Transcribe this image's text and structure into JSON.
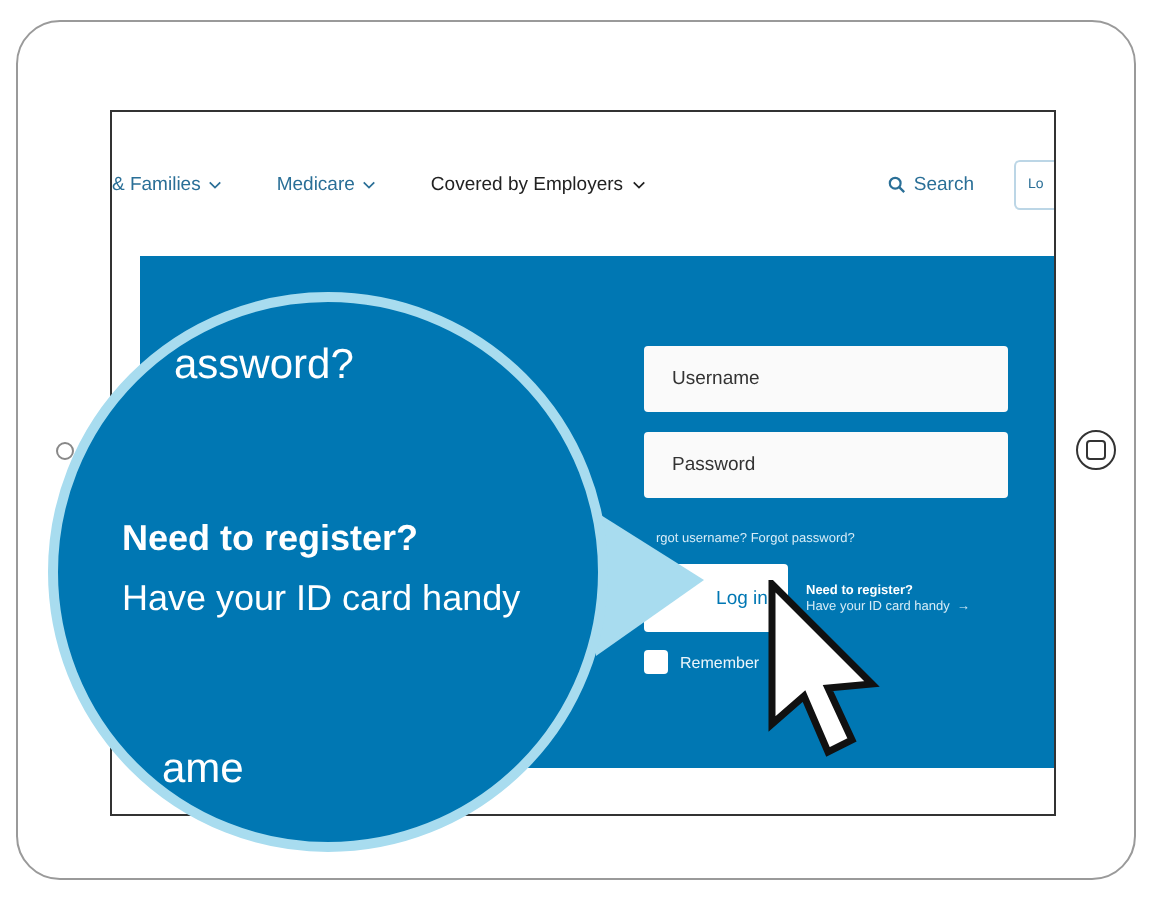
{
  "nav": {
    "items": [
      {
        "label": "& Families",
        "selected": false
      },
      {
        "label": "Medicare",
        "selected": false
      },
      {
        "label": "Covered by Employers",
        "selected": true
      }
    ],
    "search": "Search",
    "login_button": "Lo"
  },
  "login": {
    "username_placeholder": "Username",
    "password_placeholder": "Password",
    "forgot": "rgot username? Forgot password?",
    "login_button": "Log in",
    "register_title": "Need to register?",
    "register_link": "Have your ID card handy",
    "register_arrow": "→",
    "remember": {
      "label": "Remember",
      "checked": false
    }
  },
  "magnifier": {
    "top_text": "assword?",
    "title": "Need to register?",
    "subtitle": "Have your ID card handy",
    "bottom_text": "ame"
  }
}
